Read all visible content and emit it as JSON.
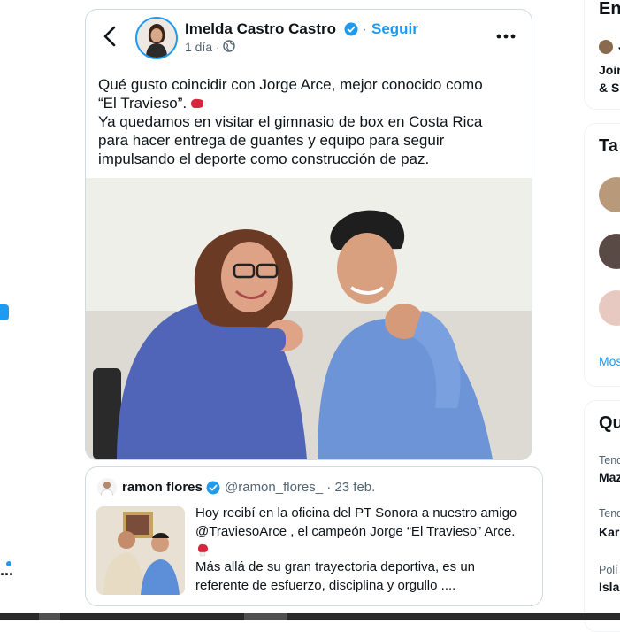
{
  "post": {
    "author_name": "Imelda Castro Castro",
    "separator": "·",
    "follow_label": "Seguir",
    "time": "1 día ·",
    "text_line_1": "Qué gusto coincidir con Jorge Arce, mejor conocido como",
    "text_line_2": "“El Travieso”.",
    "text_rest": "Ya quedamos en visitar el gimnasio de box en Costa Rica\npara hacer entrega de guantes y equipo para seguir\nimpulsando el deporte como construcción de paz."
  },
  "quote": {
    "name": "ramon flores",
    "handle": "@ramon_flores_ · 23 feb.",
    "text_part_1": "Hoy recibí en la oficina del PT Sonora a nuestro amigo\n@TraviesoArce , el campeón Jorge “El Travieso” Arce.",
    "text_part_2": "Más allá de su gran trayectoria deportiva, es un\nreferente de esfuerzo, disciplina y orgullo ...."
  },
  "sidebar": {
    "card1_title": "En",
    "card1_user": "J",
    "card1_line1": "Joir",
    "card1_line2": "& S",
    "card2_title": "Ta",
    "card2_more": "Mos",
    "card3_title": "Qu",
    "trend1_label": "Tend",
    "trend1_name": "Maz",
    "trend2_label": "Tend",
    "trend2_name": "Kar",
    "trend3_label": "Polí",
    "trend3_name": "Isla"
  },
  "left": {
    "ellipsis": "..."
  },
  "colors": {
    "accent": "#1d9bf0",
    "text": "#0f1419",
    "muted": "#536471",
    "border": "#cfd9de"
  },
  "icons": [
    "back-arrow-icon",
    "verified-icon",
    "globe-icon",
    "more-icon",
    "boxing-glove-icon"
  ]
}
